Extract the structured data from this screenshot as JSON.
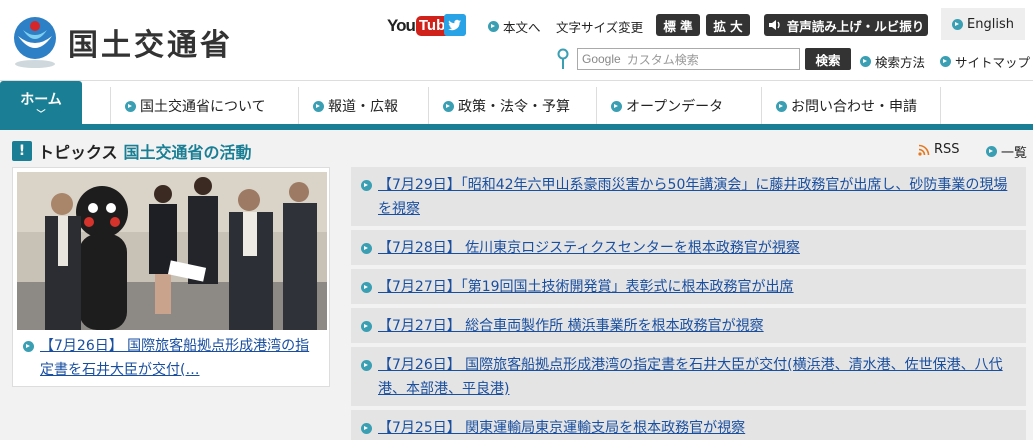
{
  "header": {
    "site_title": "国土交通省",
    "youtube": {
      "you": "You",
      "tube": "Tube"
    },
    "skip_to_content": "本文へ",
    "text_size_label": "文字サイズ変更",
    "size_standard": "標 準",
    "size_large": "拡 大",
    "voice_reader": "音声読み上げ・ルビ振り",
    "english": "English",
    "search": {
      "google_label": "Google",
      "placeholder": "カスタム検索",
      "button": "検索"
    },
    "search_method": "検索方法",
    "sitemap": "サイトマップ"
  },
  "nav": {
    "home": "ホーム",
    "about": "国土交通省について",
    "press": "報道・広報",
    "policy": "政策・法令・予算",
    "opendata": "オープンデータ",
    "contact": "お問い合わせ・申請"
  },
  "topics": {
    "title": "トピックス",
    "subtitle": "国土交通省の活動",
    "mark": "!",
    "rss": "RSS",
    "all_list": "一覧",
    "feature": {
      "text": "【7月26日】 国際旅客船拠点形成港湾の指定書を石井大臣が交付(…"
    },
    "items": [
      {
        "text": "【7月29日】「昭和42年六甲山系豪雨災害から50年講演会」に藤井政務官が出席し、砂防事業の現場を視察"
      },
      {
        "text": "【7月28日】 佐川東京ロジスティクスセンターを根本政務官が視察"
      },
      {
        "text": "【7月27日】「第19回国土技術開発賞」表彰式に根本政務官が出席"
      },
      {
        "text": "【7月27日】 総合車両製作所 横浜事業所を根本政務官が視察"
      },
      {
        "text": "【7月26日】 国際旅客船拠点形成港湾の指定書を石井大臣が交付(横浜港、清水港、佐世保港、八代港、本部港、平良港)"
      },
      {
        "text": "【7月25日】 関東運輸局東京運輸支局を根本政務官が視察"
      }
    ]
  },
  "colors": {
    "brand": "#1a7f94",
    "link": "#1a4fa0",
    "youtube_red": "#d0211b",
    "twitter_blue": "#2aa3e6"
  }
}
